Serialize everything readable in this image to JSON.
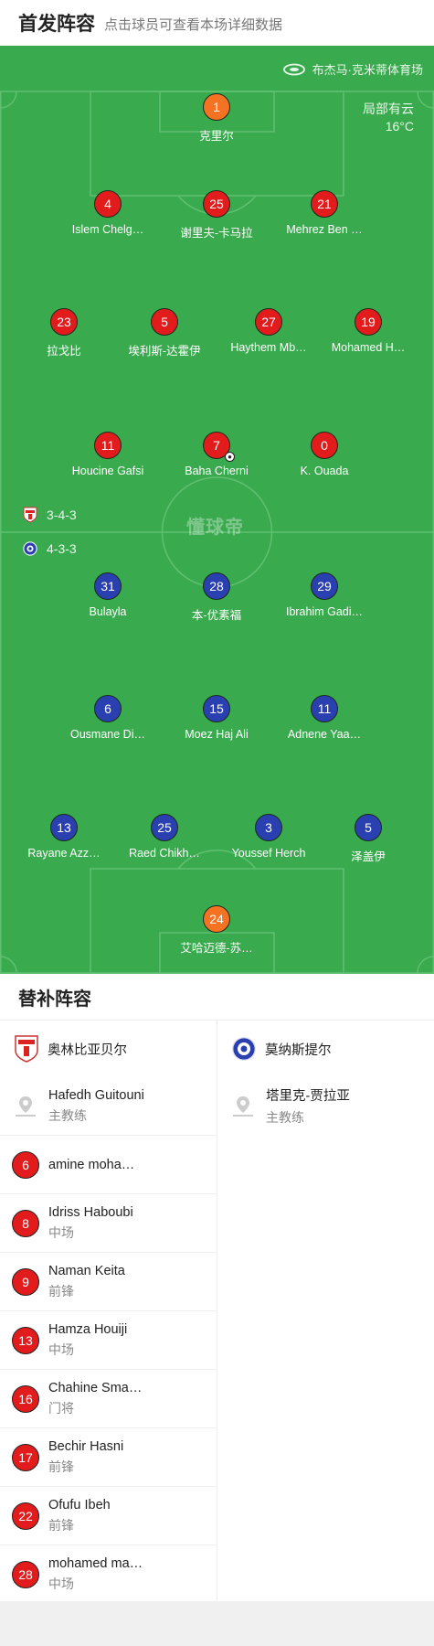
{
  "header": {
    "title": "首发阵容",
    "subtitle": "点击球员可查看本场详细数据"
  },
  "pitch": {
    "stadium": "布杰马·克米蒂体育场",
    "weather": "局部有云",
    "temperature": "16°C",
    "watermark": "懂球帝",
    "home_formation": "3-4-3",
    "away_formation": "4-3-3"
  },
  "home_players": [
    {
      "number": "1",
      "name": "克里尔",
      "color": "orange"
    },
    {
      "number": "4",
      "name": "Islem Chelg…",
      "color": "red"
    },
    {
      "number": "25",
      "name": "谢里夫-卡马拉",
      "color": "red"
    },
    {
      "number": "21",
      "name": "Mehrez Ben …",
      "color": "red"
    },
    {
      "number": "23",
      "name": "拉戈比",
      "color": "red"
    },
    {
      "number": "5",
      "name": "埃利斯-达霍伊",
      "color": "red"
    },
    {
      "number": "27",
      "name": "Haythem Mb…",
      "color": "red"
    },
    {
      "number": "19",
      "name": "Mohamed H…",
      "color": "red"
    },
    {
      "number": "11",
      "name": "Houcine Gafsi",
      "color": "red"
    },
    {
      "number": "7",
      "name": "Baha Cherni",
      "color": "red"
    },
    {
      "number": "0",
      "name": "K. Ouada",
      "color": "red"
    }
  ],
  "away_players": [
    {
      "number": "31",
      "name": "Bulayla",
      "color": "blue"
    },
    {
      "number": "28",
      "name": "本-优素福",
      "color": "blue"
    },
    {
      "number": "29",
      "name": "Ibrahim Gadi…",
      "color": "blue"
    },
    {
      "number": "6",
      "name": "Ousmane Di…",
      "color": "blue"
    },
    {
      "number": "15",
      "name": "Moez Haj Ali",
      "color": "blue"
    },
    {
      "number": "11",
      "name": "Adnene Yaa…",
      "color": "blue"
    },
    {
      "number": "13",
      "name": "Rayane Azz…",
      "color": "blue"
    },
    {
      "number": "25",
      "name": "Raed Chikh…",
      "color": "blue"
    },
    {
      "number": "3",
      "name": "Youssef Herch",
      "color": "blue"
    },
    {
      "number": "5",
      "name": "泽盖伊",
      "color": "blue"
    },
    {
      "number": "24",
      "name": "艾哈迈德-苏…",
      "color": "orange"
    }
  ],
  "subs": {
    "title": "替补阵容",
    "home": {
      "team": "奥林比亚贝尔",
      "coach": {
        "name": "Hafedh Guitouni",
        "role": "主教练"
      },
      "players": [
        {
          "number": "6",
          "name": "amine moha…",
          "pos": ""
        },
        {
          "number": "8",
          "name": "Idriss Haboubi",
          "pos": "中场"
        },
        {
          "number": "9",
          "name": "Naman Keita",
          "pos": "前锋"
        },
        {
          "number": "13",
          "name": "Hamza Houiji",
          "pos": "中场"
        },
        {
          "number": "16",
          "name": "Chahine Sma…",
          "pos": "门将"
        },
        {
          "number": "17",
          "name": "Bechir Hasni",
          "pos": "前锋"
        },
        {
          "number": "22",
          "name": "Ofufu Ibeh",
          "pos": "前锋"
        },
        {
          "number": "28",
          "name": "mohamed ma…",
          "pos": "中场"
        }
      ]
    },
    "away": {
      "team": "莫纳斯提尔",
      "coach": {
        "name": "塔里克-贾拉亚",
        "role": "主教练"
      }
    }
  },
  "colors": {
    "pitch": "#3aaa4f",
    "home": "#e21c1c",
    "away": "#2a3fb0",
    "keeper": "#f57222"
  }
}
